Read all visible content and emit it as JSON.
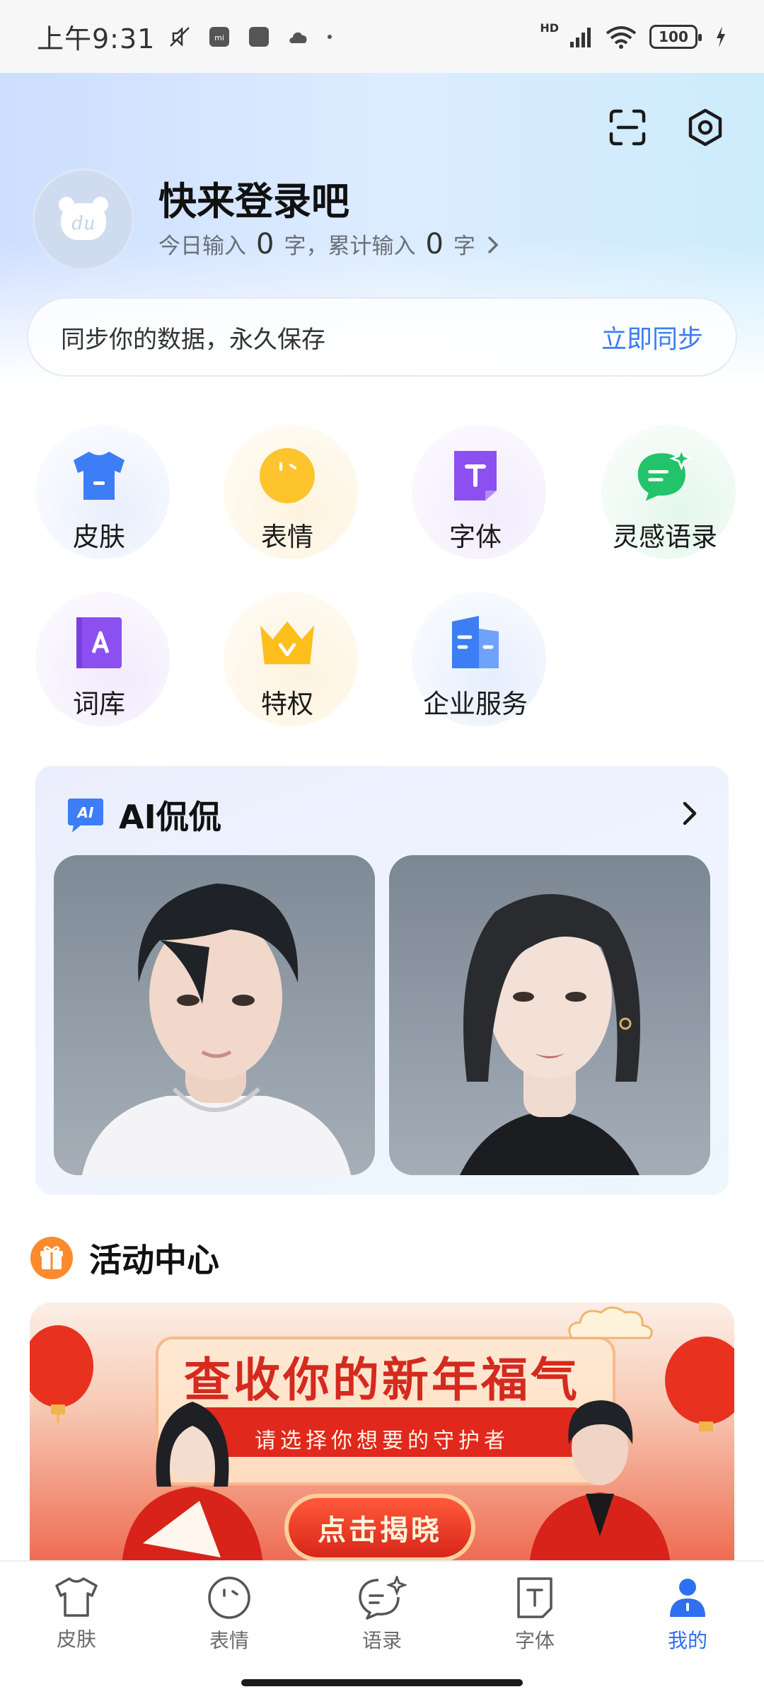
{
  "status_bar": {
    "time": "上午9:31",
    "network": "HD",
    "battery": "100"
  },
  "profile": {
    "title": "快来登录吧",
    "stats_prefix": "今日输入",
    "today_count": "0",
    "stats_mid": "字，累计输入",
    "total_count": "0",
    "stats_suffix": "字"
  },
  "sync": {
    "text": "同步你的数据，永久保存",
    "button": "立即同步"
  },
  "features": {
    "skin": "皮肤",
    "emoji": "表情",
    "font": "字体",
    "quotes": "灵感语录",
    "lexicon": "词库",
    "privilege": "特权",
    "enterprise": "企业服务"
  },
  "ai_section": {
    "badge": "AI",
    "title": "AI侃侃"
  },
  "activity": {
    "title": "活动中心",
    "banner_title": "查收你的新年福气",
    "banner_subtitle": "请选择你想要的守护者",
    "banner_button": "点击揭晓"
  },
  "bottom_nav": {
    "skin": "皮肤",
    "emoji": "表情",
    "quotes": "语录",
    "font": "字体",
    "mine": "我的"
  },
  "colors": {
    "accent": "#2f6ff2",
    "sync_link": "#3e7cf4"
  }
}
